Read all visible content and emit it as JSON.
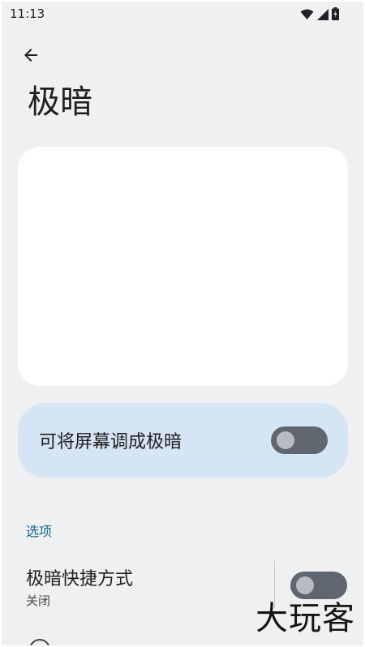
{
  "status_bar": {
    "time": "11:13",
    "icons": [
      "wifi-icon",
      "cellular-signal-icon",
      "battery-charging-icon"
    ]
  },
  "header": {
    "back_icon": "arrow-back-icon",
    "title": "极暗"
  },
  "main_toggle": {
    "label": "可将屏幕调成极暗",
    "checked": false
  },
  "options": {
    "section_title": "选项",
    "shortcut": {
      "title": "极暗快捷方式",
      "summary": "关闭",
      "checked": false
    }
  },
  "watermark": {
    "text": "大玩客"
  },
  "colors": {
    "background": "#eff0f2",
    "card": "#ffffff",
    "toggle_card": "#d6e5f4",
    "switch_track": "#5f6670",
    "section_header": "#146b8c"
  }
}
